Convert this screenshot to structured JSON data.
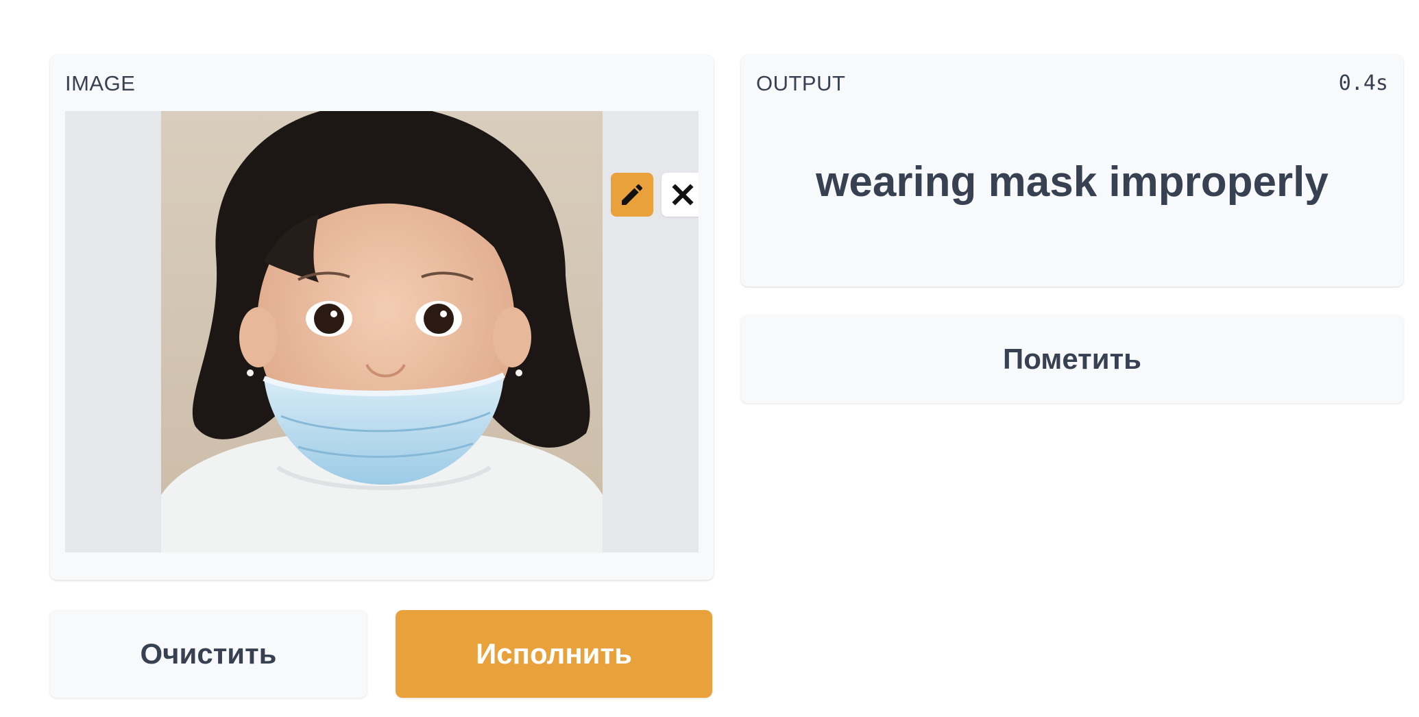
{
  "image_panel": {
    "label": "IMAGE",
    "image_alt": "child wearing face mask below nose"
  },
  "output_panel": {
    "label": "OUTPUT",
    "time": "0.4s",
    "value": "wearing mask improperly"
  },
  "actions": {
    "clear_label": "Очистить",
    "run_label": "Исполнить",
    "flag_label": "Пометить"
  },
  "icons": {
    "edit": "pencil-icon",
    "close": "close-icon"
  },
  "colors": {
    "accent": "#e9a23b",
    "panel_bg": "#f8f9fa",
    "text": "#374151",
    "image_bg": "#e5e7eb"
  }
}
